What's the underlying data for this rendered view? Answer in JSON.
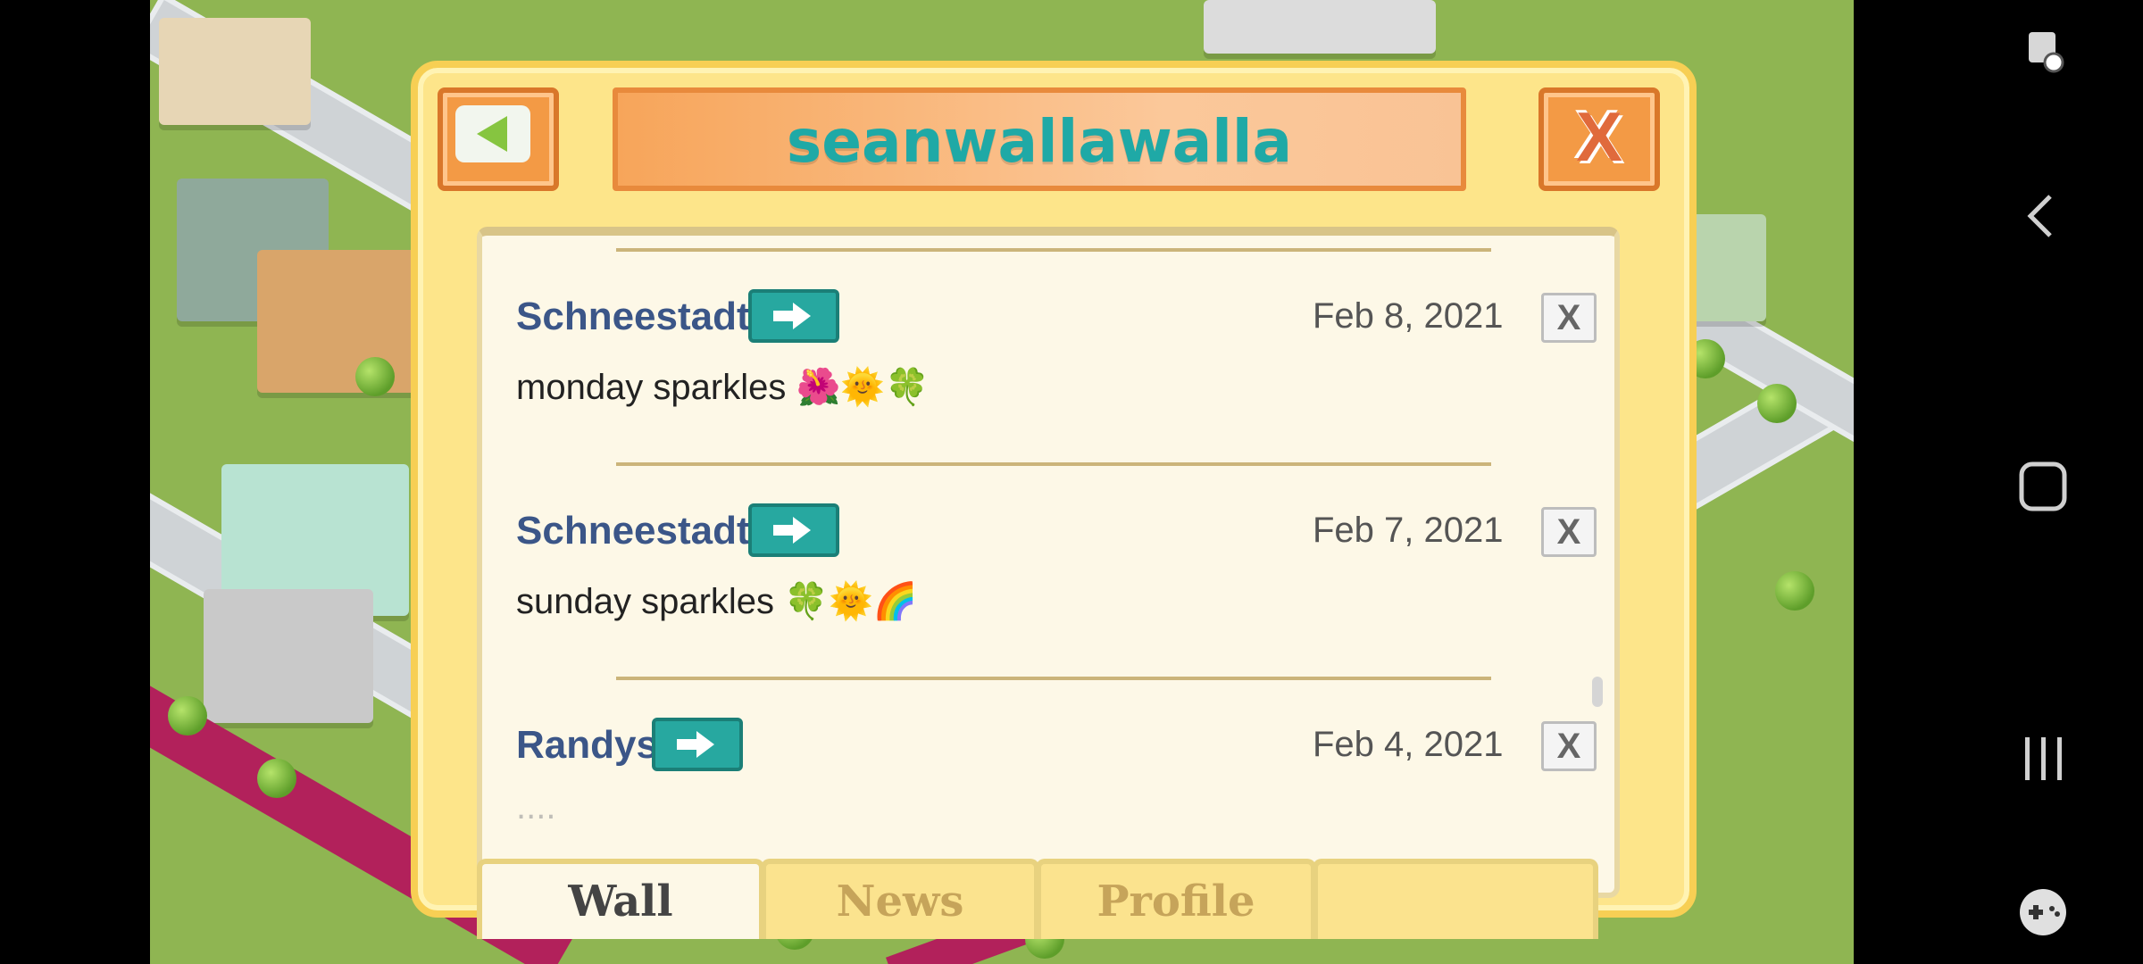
{
  "dialog": {
    "title": "seanwallawalla"
  },
  "posts": [
    {
      "author": "Schneestadt",
      "date": "Feb 8, 2021",
      "message": "monday sparkles 🌺🌞🍀"
    },
    {
      "author": "Schneestadt",
      "date": "Feb 7, 2021",
      "message": "sunday sparkles 🍀🌞🌈"
    },
    {
      "author": "Randys",
      "date": "Feb 4, 2021",
      "message": "...."
    }
  ],
  "tabs": [
    {
      "label": "Wall",
      "active": true
    },
    {
      "label": "News",
      "active": false
    },
    {
      "label": "Profile",
      "active": false
    },
    {
      "label": "",
      "active": false
    }
  ],
  "delete_glyph": "X",
  "close_glyph": "X",
  "colors": {
    "title_text": "#1fa9a6",
    "author_text": "#3b5688",
    "dialog_bg": "#fde58a",
    "title_bar": "#f7a55a",
    "go_button": "#27a8a0"
  },
  "icons": {
    "back": "back-arrow-icon",
    "close": "close-x-icon",
    "go": "go-arrow-icon",
    "nav_back": "android-back-icon",
    "nav_home": "android-home-icon",
    "nav_recents": "android-recents-icon"
  }
}
